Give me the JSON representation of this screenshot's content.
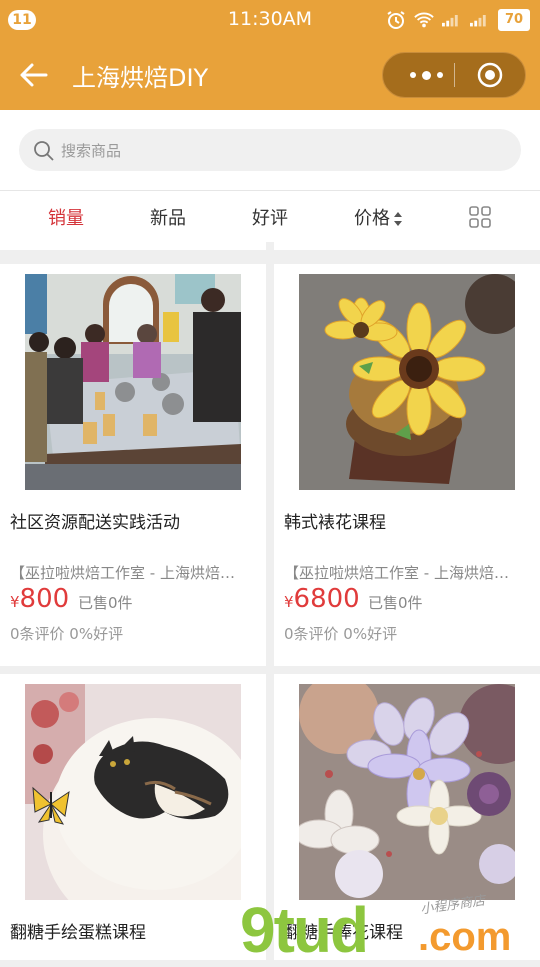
{
  "status_bar": {
    "notification_count": "11",
    "time": "11:30AM",
    "battery": "70"
  },
  "nav": {
    "title": "上海烘焙DIY"
  },
  "search": {
    "placeholder": "搜索商品"
  },
  "sort_tabs": [
    {
      "label": "销量",
      "active": true
    },
    {
      "label": "新品"
    },
    {
      "label": "好评"
    },
    {
      "label": "价格"
    }
  ],
  "products": [
    {
      "name": "社区资源配送实践活动",
      "shop": "【巫拉啦烘焙工作室 - 上海烘焙…",
      "currency": "¥",
      "price": "800",
      "sold": "已售0件",
      "reviews": "0条评价 0%好评"
    },
    {
      "name": "韩式裱花课程",
      "shop": "【巫拉啦烘焙工作室 - 上海烘焙…",
      "currency": "¥",
      "price": "6800",
      "sold": "已售0件",
      "reviews": "0条评价 0%好评"
    },
    {
      "name": "翻糖手绘蛋糕课程"
    },
    {
      "name": "翻糖手捧花课程"
    }
  ],
  "watermark": {
    "part1": "9tud",
    "part2": ".com",
    "part3": "小程序商店"
  },
  "colors": {
    "brand": "#e8a23a",
    "active_tab": "#d4343a",
    "price": "#e03b3b"
  }
}
